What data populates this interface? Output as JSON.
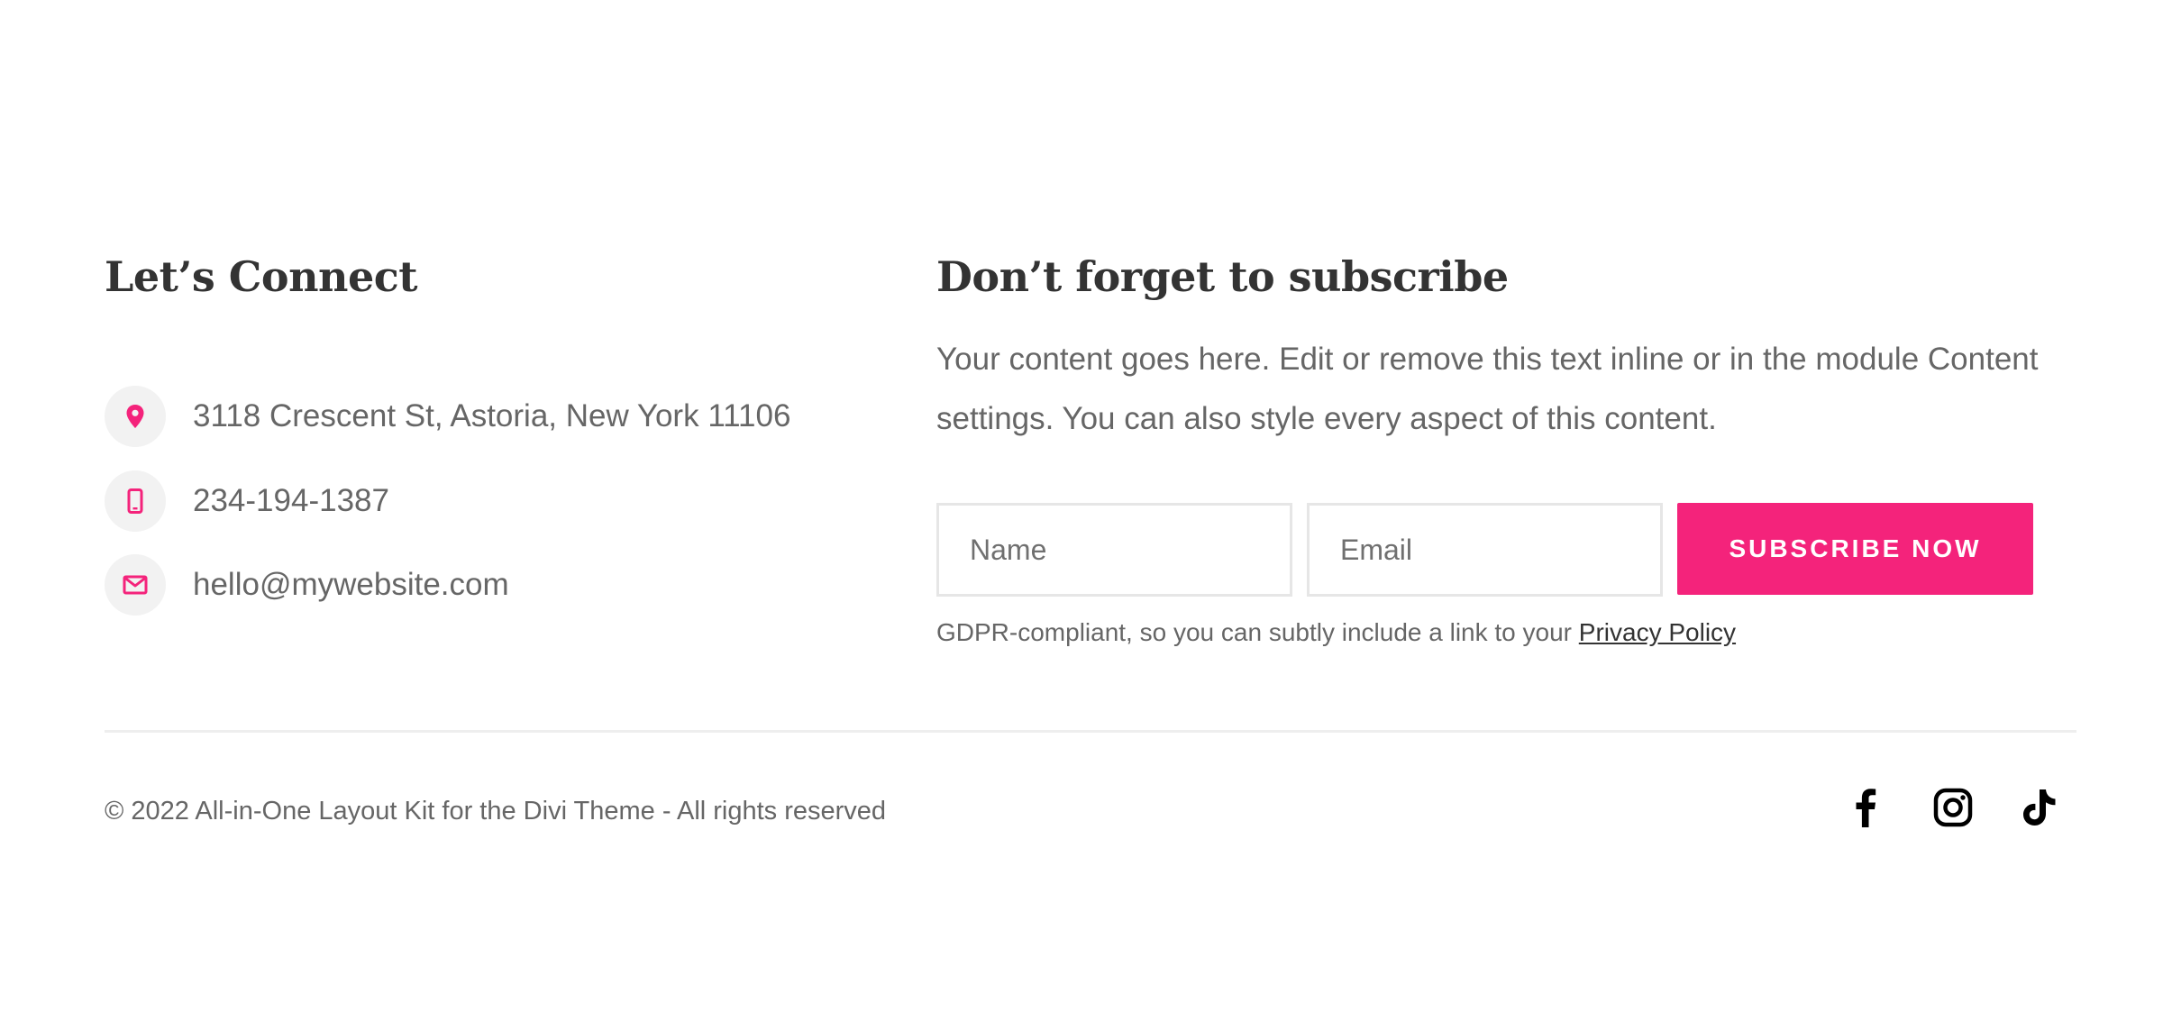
{
  "connect": {
    "title": "Let’s Connect",
    "items": [
      {
        "icon": "location-pin-icon",
        "text": "3118 Crescent St, Astoria, New York 11106"
      },
      {
        "icon": "mobile-phone-icon",
        "text": "234-194-1387"
      },
      {
        "icon": "envelope-icon",
        "text": "hello@mywebsite.com"
      }
    ]
  },
  "subscribe": {
    "title": "Don’t forget to subscribe",
    "description": "Your content goes here. Edit or remove this text inline or in the module Content settings. You can also style every aspect of this content.",
    "name_placeholder": "Name",
    "email_placeholder": "Email",
    "button_label": "SUBSCRIBE NOW",
    "gdpr_text": "GDPR-compliant, so you can subtly include a link to your ",
    "privacy_link": "Privacy Policy"
  },
  "footer": {
    "copyright": "© 2022 All-in-One Layout Kit for the Divi Theme - All rights reserved",
    "social": [
      "facebook-icon",
      "instagram-icon",
      "tiktok-icon"
    ]
  },
  "colors": {
    "accent": "#f4237b",
    "heading": "#333333",
    "body_text": "#666666",
    "icon_bg": "#f2f2f2",
    "social_icon": "#000000"
  }
}
